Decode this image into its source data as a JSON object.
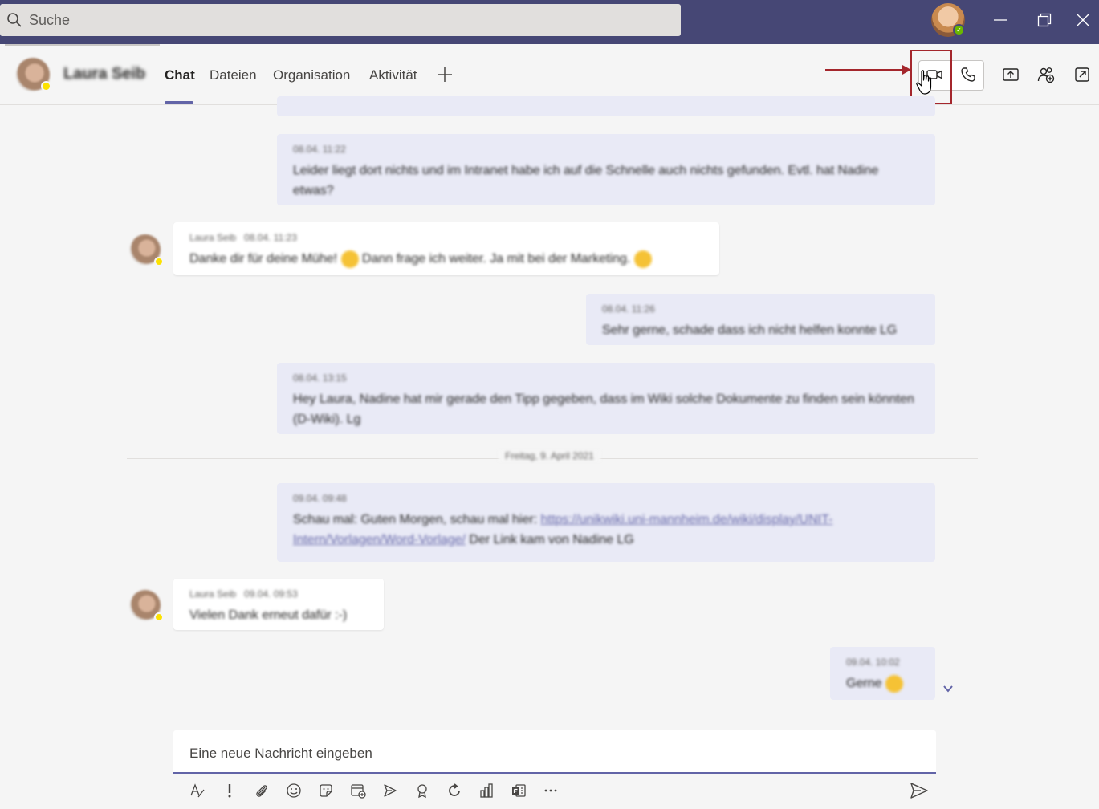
{
  "search": {
    "placeholder": "Suche"
  },
  "header": {
    "contact_name": "Laura Seib",
    "tabs": [
      {
        "label": "Chat",
        "active": true
      },
      {
        "label": "Dateien",
        "active": false
      },
      {
        "label": "Organisation",
        "active": false
      },
      {
        "label": "Aktivität",
        "active": false
      }
    ],
    "add_tab_icon": "plus-icon",
    "actions": [
      "video-call-icon",
      "audio-call-icon",
      "share-screen-icon",
      "add-people-icon",
      "pop-out-icon"
    ]
  },
  "messages": [
    {
      "from": "me",
      "time": "08.04. 11:22",
      "text": "Leider liegt dort nichts und im Intranet habe ich auf die Schnelle auch nichts gefunden. Evtl. hat Nadine etwas?"
    },
    {
      "from": "them",
      "author": "Laura Seib",
      "time": "08.04. 11:23",
      "text_a": "Danke dir für deine Mühe!",
      "text_b": "Dann frage ich weiter. Ja mit bei der Marketing."
    },
    {
      "from": "me",
      "time": "08.04. 11:26",
      "text": "Sehr gerne, schade dass ich nicht helfen konnte LG"
    },
    {
      "from": "me",
      "time": "08.04. 13:15",
      "text": "Hey Laura, Nadine hat mir gerade den Tipp gegeben, dass im Wiki solche Dokumente zu finden sein könnten (D-Wiki). Lg"
    },
    {
      "from": "me",
      "time": "09.04. 09:48",
      "text_a": "Schau mal: Guten Morgen, schau mal hier:",
      "link": "https://unikwiki.uni-mannheim.de/wiki/display/UNIT-Intern/Vorlagen/Word-Vorlage/",
      "text_b": "Der Link kam von Nadine LG"
    },
    {
      "from": "them",
      "author": "Laura Seib",
      "time": "09.04. 09:53",
      "text": "Vielen Dank erneut dafür :-)"
    },
    {
      "from": "me",
      "time": "09.04. 10:02",
      "text": "Gerne"
    }
  ],
  "date_separator": "Freitag, 9. April 2021",
  "compose": {
    "placeholder": "Eine neue Nachricht eingeben"
  },
  "toolbar_icons": [
    "format-icon",
    "priority-icon",
    "attach-icon",
    "emoji-icon",
    "sticker-icon",
    "schedule-meeting-icon",
    "stream-icon",
    "praise-icon",
    "loop-icon",
    "insights-icon",
    "forms-icon",
    "more-icon",
    "send-icon"
  ],
  "colors": {
    "titlebar": "#464775",
    "accent": "#6264a7",
    "highlight": "#a4262c",
    "my_bubble": "#e9eaf6"
  }
}
